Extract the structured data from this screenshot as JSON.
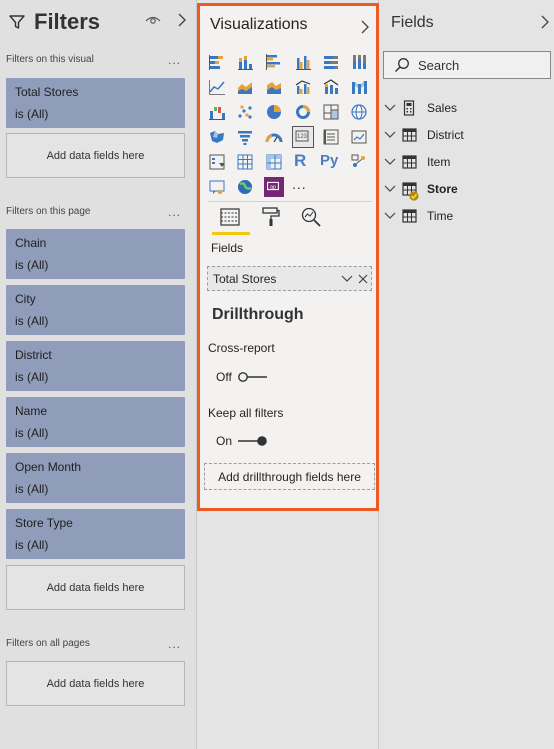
{
  "filters": {
    "title": "Filters",
    "sections": {
      "visual": {
        "label": "Filters on this visual",
        "more": "...",
        "add": "Add data fields here"
      },
      "page": {
        "label": "Filters on this page",
        "more": "...",
        "add": "Add data fields here"
      },
      "all": {
        "label": "Filters on all pages",
        "more": "...",
        "add": "Add data fields here"
      }
    },
    "visual_cards": [
      {
        "name": "Total Stores",
        "value": "is (All)"
      }
    ],
    "page_cards": [
      {
        "name": "Chain",
        "value": "is (All)"
      },
      {
        "name": "City",
        "value": "is (All)"
      },
      {
        "name": "District",
        "value": "is (All)"
      },
      {
        "name": "Name",
        "value": "is (All)"
      },
      {
        "name": "Open Month",
        "value": "is (All)"
      },
      {
        "name": "Store Type",
        "value": "is (All)"
      }
    ]
  },
  "visualizations": {
    "title": "Visualizations",
    "gallery": [
      "stacked-bar-chart-icon",
      "stacked-column-chart-icon",
      "clustered-bar-chart-icon",
      "clustered-column-chart-icon",
      "100-stacked-bar-chart-icon",
      "100-stacked-column-chart-icon",
      "line-chart-icon",
      "area-chart-icon",
      "stacked-area-chart-icon",
      "line-clustered-column-icon",
      "line-stacked-column-icon",
      "ribbon-chart-icon",
      "waterfall-chart-icon",
      "scatter-chart-icon",
      "pie-chart-icon",
      "donut-chart-icon",
      "treemap-icon",
      "map-icon",
      "filled-map-icon",
      "funnel-icon",
      "gauge-icon",
      "card-icon",
      "multi-row-card-icon",
      "kpi-icon",
      "slicer-icon",
      "table-icon",
      "matrix-icon",
      "r-visual-icon",
      "python-visual-icon",
      "key-influencers-icon",
      "qa-icon",
      "arcgis-map-icon",
      "power-apps-icon",
      "more-visuals-icon"
    ],
    "more_label": "...",
    "r_glyph": "R",
    "py_glyph": "Py",
    "fields_label": "Fields",
    "field_well_value": "Total Stores",
    "drillthrough_title": "Drillthrough",
    "cross_report_label": "Cross-report",
    "cross_report_state": "Off",
    "keep_filters_label": "Keep all filters",
    "keep_filters_state": "On",
    "add_drillthrough": "Add drillthrough fields here",
    "accent": "#ec5b24",
    "tab_accent": "#f2c811"
  },
  "fields_pane": {
    "title": "Fields",
    "search_placeholder": "Search",
    "tables": [
      {
        "name": "Sales",
        "icon": "calculator-icon",
        "bold": false
      },
      {
        "name": "District",
        "icon": "table-icon",
        "bold": false
      },
      {
        "name": "Item",
        "icon": "table-icon",
        "bold": false
      },
      {
        "name": "Store",
        "icon": "table-icon",
        "bold": true,
        "checked": true
      },
      {
        "name": "Time",
        "icon": "table-icon",
        "bold": false
      }
    ]
  }
}
